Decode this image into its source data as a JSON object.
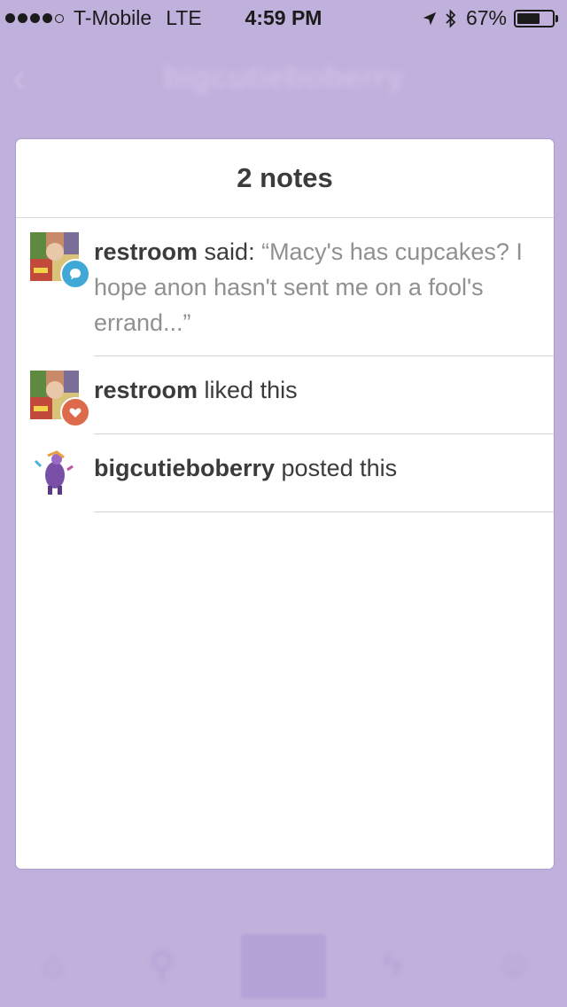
{
  "status_bar": {
    "carrier": "T-Mobile",
    "network": "LTE",
    "time": "4:59 PM",
    "battery_percent": "67%",
    "battery_level": 0.67
  },
  "nav": {
    "title": "bigcutieboberry",
    "back_icon": "chevron-left-icon"
  },
  "notes": {
    "title": "2 notes",
    "items": [
      {
        "user": "restroom",
        "action": " said: ",
        "quote": "“Macy's has cupcakes? I hope anon hasn't sent me on a fool's errand...”",
        "badge": "reply-bubble-icon",
        "badge_color": "#3fa8d7"
      },
      {
        "user": "restroom",
        "action": " liked this",
        "quote": "",
        "badge": "heart-icon",
        "badge_color": "#dd6a4a"
      },
      {
        "user": "bigcutieboberry",
        "action": " posted this",
        "quote": "",
        "badge": "",
        "badge_color": ""
      }
    ]
  },
  "colors": {
    "background": "#bfb0dc",
    "card": "#ffffff"
  }
}
